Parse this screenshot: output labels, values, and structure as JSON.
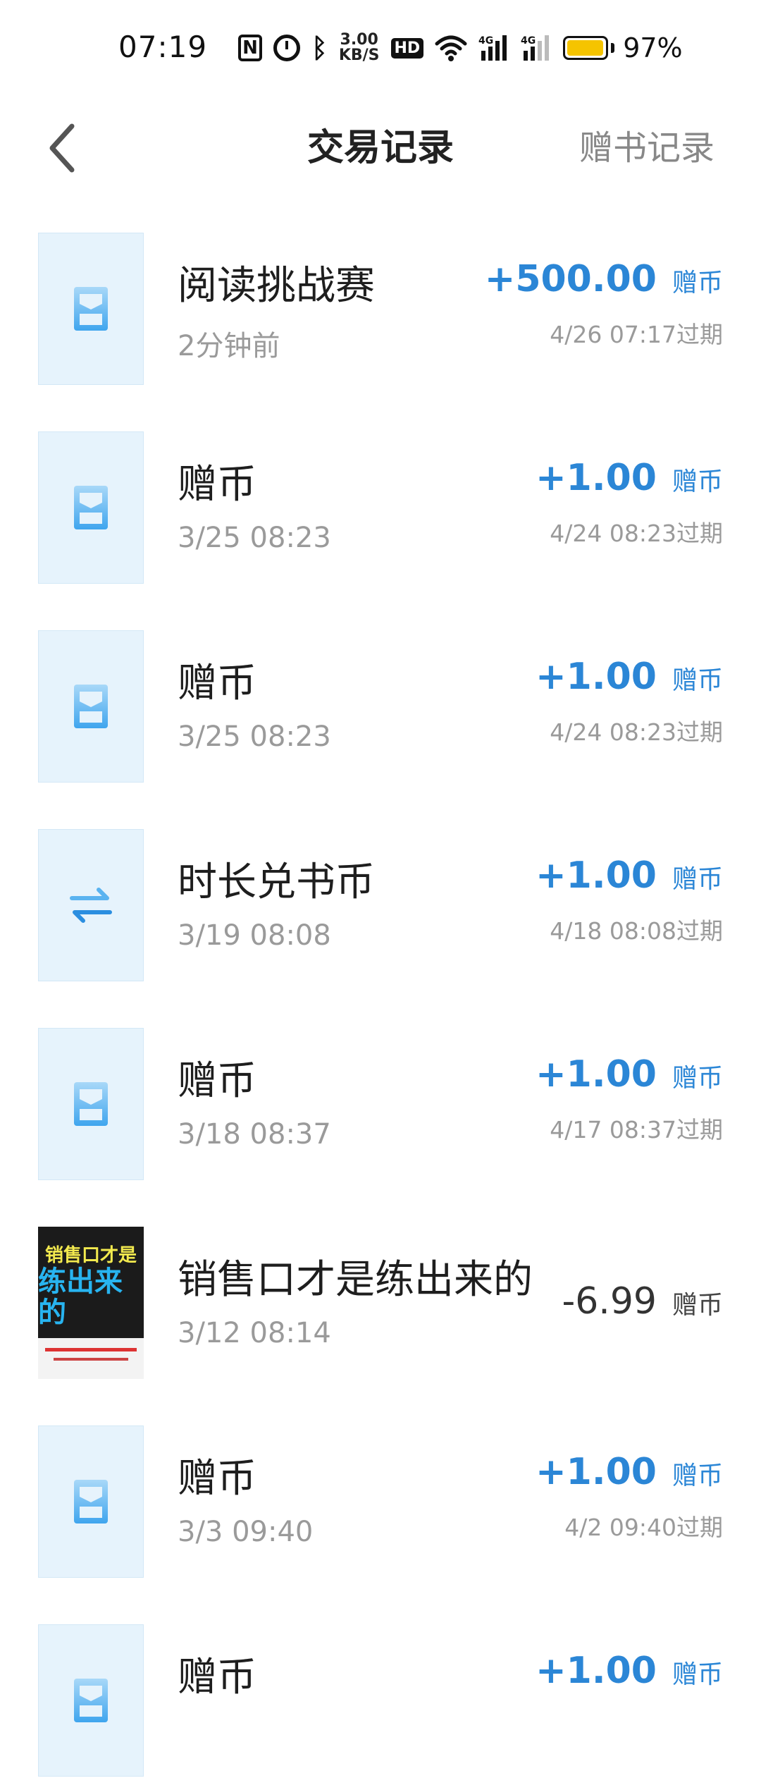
{
  "status_bar": {
    "time": "07:19",
    "speed_value": "3.00",
    "speed_unit": "KB/S",
    "hd_label": "HD",
    "battery_percent": "97%",
    "battery_level": 0.97,
    "battery_color": "#f5c400"
  },
  "header": {
    "title": "交易记录",
    "right_link": "赠书记录"
  },
  "colors": {
    "accent": "#2b86d6",
    "muted": "#9a9a9a"
  },
  "transactions": [
    {
      "title": "阅读挑战赛",
      "time": "2分钟前",
      "amount": "+500.00",
      "unit": "赠币",
      "expiry": "4/26 07:17过期",
      "icon": "card-icon"
    },
    {
      "title": "赠币",
      "time": "3/25 08:23",
      "amount": "+1.00",
      "unit": "赠币",
      "expiry": "4/24 08:23过期",
      "icon": "card-icon"
    },
    {
      "title": "赠币",
      "time": "3/25 08:23",
      "amount": "+1.00",
      "unit": "赠币",
      "expiry": "4/24 08:23过期",
      "icon": "card-icon"
    },
    {
      "title": "时长兑书币",
      "time": "3/19 08:08",
      "amount": "+1.00",
      "unit": "赠币",
      "expiry": "4/18 08:08过期",
      "icon": "exchange-icon"
    },
    {
      "title": "赠币",
      "time": "3/18 08:37",
      "amount": "+1.00",
      "unit": "赠币",
      "expiry": "4/17 08:37过期",
      "icon": "card-icon"
    },
    {
      "title": "销售口才是练出来的",
      "time": "3/12 08:14",
      "amount": "-6.99",
      "unit": "赠币",
      "expiry": "",
      "icon": "book-cover",
      "cover_line1": "销售口才是",
      "cover_line2": "练出来的"
    },
    {
      "title": "赠币",
      "time": "3/3 09:40",
      "amount": "+1.00",
      "unit": "赠币",
      "expiry": "4/2 09:40过期",
      "icon": "card-icon"
    },
    {
      "title": "赠币",
      "time": "",
      "amount": "+1.00",
      "unit": "赠币",
      "expiry": "",
      "icon": "card-icon"
    }
  ]
}
